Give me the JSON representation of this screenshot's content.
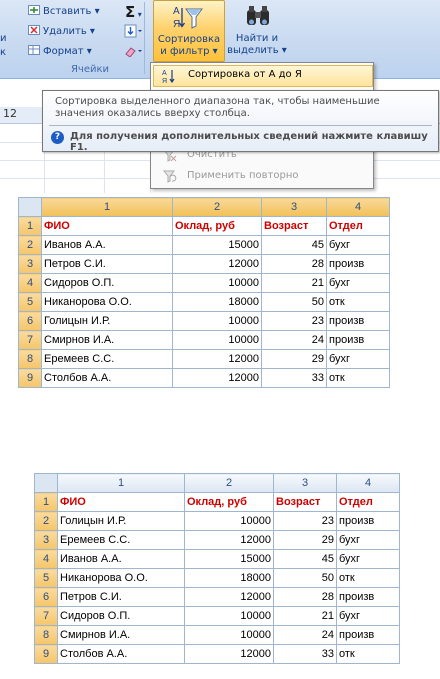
{
  "ribbon": {
    "insert": "Вставить",
    "delete": "Удалить",
    "format": "Формат",
    "group_cells": "Ячейки",
    "left_fragment_1": "и",
    "left_fragment_2": "к",
    "sigma": "Σ",
    "sort_filter_line1": "Сортировка",
    "sort_filter_line2": "и фильтр",
    "find_select_line1": "Найти и",
    "find_select_line2": "выделить"
  },
  "menu": {
    "sort_az": "Сортировка от А до Я",
    "clear": "Очистить",
    "reapply": "Применить повторно"
  },
  "tooltip": {
    "description": "Сортировка выделенного диапазона так, чтобы наименьшие значения оказались вверху столбца.",
    "help": "Для получения дополнительных сведений нажмите клавишу F1."
  },
  "behind": {
    "column_number": "12"
  },
  "table_before": {
    "col_headers": [
      "1",
      "2",
      "3",
      "4"
    ],
    "header": [
      "ФИО",
      "Оклад, руб",
      "Возраст",
      "Отдел"
    ],
    "rows": [
      [
        "Иванов А.А.",
        "15000",
        "45",
        "бухг"
      ],
      [
        "Петров С.И.",
        "12000",
        "28",
        "произв"
      ],
      [
        "Сидоров О.П.",
        "10000",
        "21",
        "бухг"
      ],
      [
        "Никанорова О.О.",
        "18000",
        "50",
        "отк"
      ],
      [
        "Голицын И.Р.",
        "10000",
        "23",
        "произв"
      ],
      [
        "Смирнов И.А.",
        "10000",
        "24",
        "произв"
      ],
      [
        "Еремеев С.С.",
        "12000",
        "29",
        "бухг"
      ],
      [
        "Столбов А.А.",
        "12000",
        "33",
        "отк"
      ]
    ]
  },
  "table_after": {
    "col_headers": [
      "1",
      "2",
      "3",
      "4"
    ],
    "header": [
      "ФИО",
      "Оклад, руб",
      "Возраст",
      "Отдел"
    ],
    "rows": [
      [
        "Голицын И.Р.",
        "10000",
        "23",
        "произв"
      ],
      [
        "Еремеев С.С.",
        "12000",
        "29",
        "бухг"
      ],
      [
        "Иванов А.А.",
        "15000",
        "45",
        "бухг"
      ],
      [
        "Никанорова О.О.",
        "18000",
        "50",
        "отк"
      ],
      [
        "Петров С.И.",
        "12000",
        "28",
        "произв"
      ],
      [
        "Сидоров О.П.",
        "10000",
        "21",
        "бухг"
      ],
      [
        "Смирнов И.А.",
        "10000",
        "24",
        "произв"
      ],
      [
        "Столбов А.А.",
        "12000",
        "33",
        "отк"
      ]
    ]
  },
  "row_numbers": [
    "1",
    "2",
    "3",
    "4",
    "5",
    "6",
    "7",
    "8",
    "9"
  ]
}
